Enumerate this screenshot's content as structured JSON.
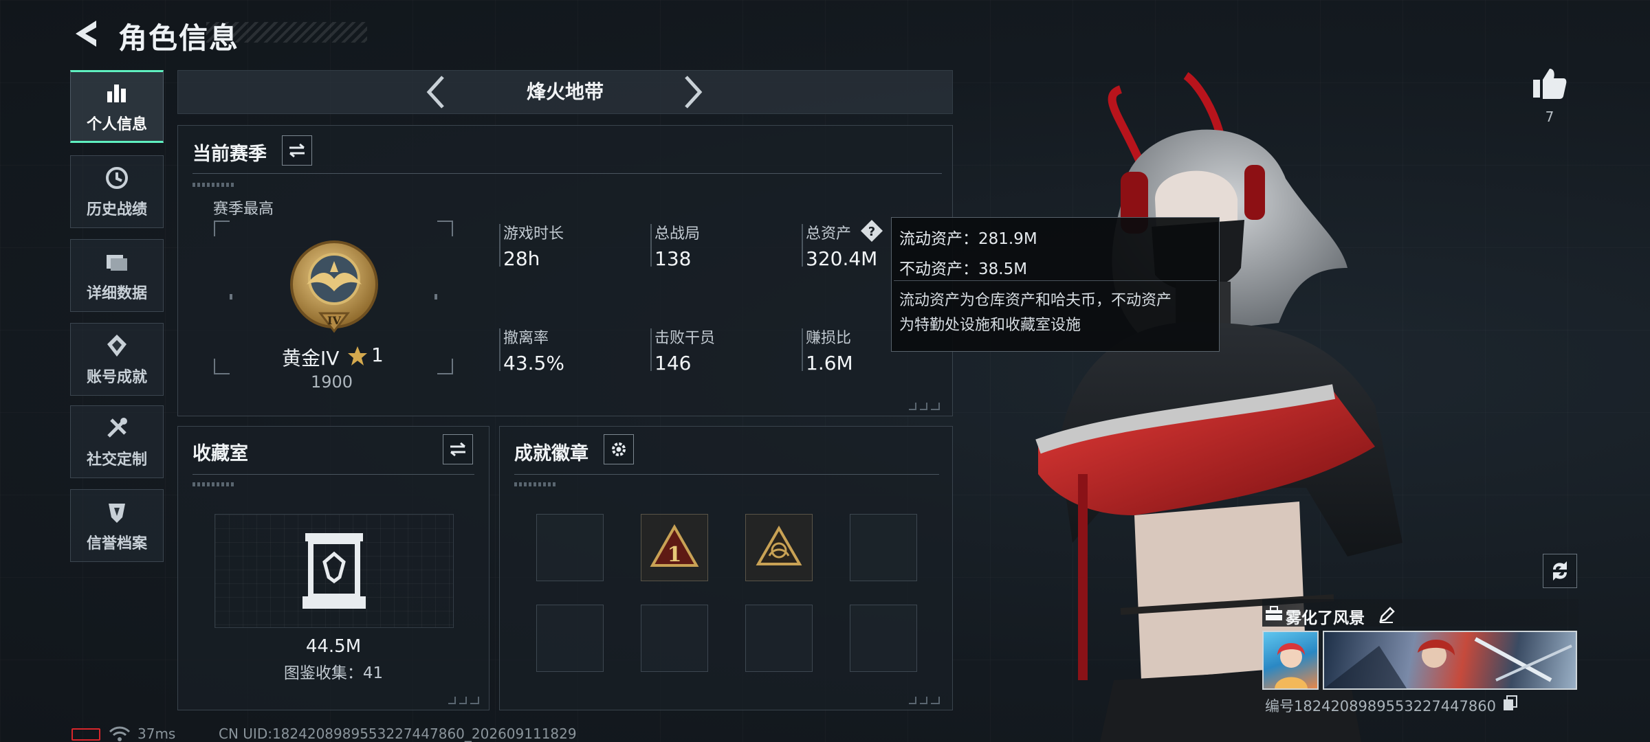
{
  "header": {
    "title": "角色信息"
  },
  "sidebar": {
    "items": [
      {
        "label": "个人信息",
        "icon": "bar-chart-icon",
        "active": true
      },
      {
        "label": "历史战绩",
        "icon": "clock-icon",
        "active": false
      },
      {
        "label": "详细数据",
        "icon": "folder-icon",
        "active": false
      },
      {
        "label": "账号成就",
        "icon": "achievement-icon",
        "active": false
      },
      {
        "label": "社交定制",
        "icon": "tools-icon",
        "active": false
      },
      {
        "label": "信誉档案",
        "icon": "shield-icon",
        "active": false
      }
    ]
  },
  "mode": {
    "title": "烽火地带"
  },
  "season": {
    "title": "当前赛季",
    "best_label": "赛季最高",
    "rank_name": "黄金IV",
    "rank_stars": "1",
    "rank_score": "1900",
    "stats": [
      {
        "label": "游戏时长",
        "value": "28h"
      },
      {
        "label": "总战局",
        "value": "138"
      },
      {
        "label": "总资产",
        "value": "320.4M"
      },
      {
        "label": "撤离率",
        "value": "43.5%"
      },
      {
        "label": "击败干员",
        "value": "146"
      },
      {
        "label": "赚损比",
        "value": "1.6M"
      }
    ]
  },
  "tooltip": {
    "liquid": "流动资产：281.9M",
    "fixed": "不动资产：38.5M",
    "desc_line1": "流动资产为仓库资产和哈夫币，不动资产",
    "desc_line2": "为特勤处设施和收藏室设施"
  },
  "collection": {
    "title": "收藏室",
    "value": "44.5M",
    "count_label": "图鉴收集：41"
  },
  "badges": {
    "title": "成就徽章",
    "slots": [
      "empty",
      "rank-1-badge",
      "emblem-badge",
      "empty",
      "empty",
      "empty",
      "empty",
      "empty"
    ]
  },
  "social": {
    "likes": "7",
    "player_name": "雾化了风景",
    "player_id": "编号1824208989553227447860"
  },
  "status": {
    "ping": "37ms",
    "uid": "CN UID:1824208989553227447860_202609111829"
  },
  "colors": {
    "accent": "#5ff0c0",
    "gold": "#c9a255",
    "character_red": "#c0242c"
  }
}
